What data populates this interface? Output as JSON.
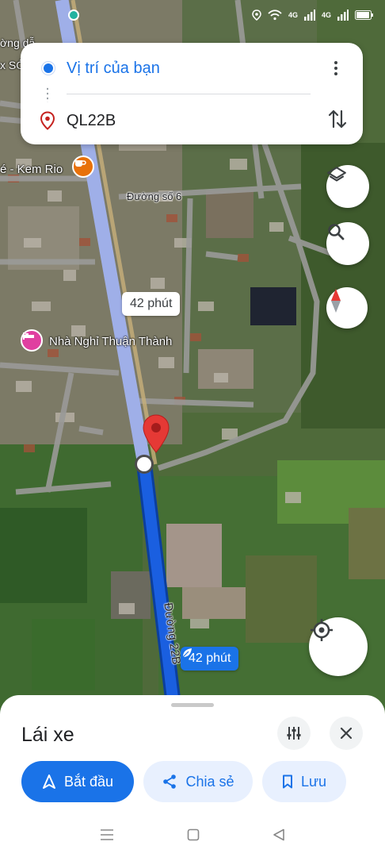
{
  "status_bar": {
    "network_left": "4G",
    "network_right": "4G"
  },
  "directions": {
    "origin": "Vị trí của bạn",
    "destination": "QL22B"
  },
  "map": {
    "poi_cafe": "é - Kem Rio",
    "poi_hotel": "Nhà Nghỉ Thuận Thành",
    "street_top": "Đường số 6",
    "route_road": "Đường 22B",
    "top_left_fragment": "ờng dẫ",
    "top_left_fragment2": "x SÓ",
    "eta_alt": "42 phút",
    "eta_main": "42 phút"
  },
  "sheet": {
    "mode": "Lái xe",
    "start_label": "Bắt đầu",
    "share_label": "Chia sẻ",
    "save_label": "Lưu"
  },
  "colors": {
    "accent": "#1a73e8",
    "route_main": "#1a5fe0",
    "route_alt": "#aab8ee",
    "pin": "#e53935"
  }
}
